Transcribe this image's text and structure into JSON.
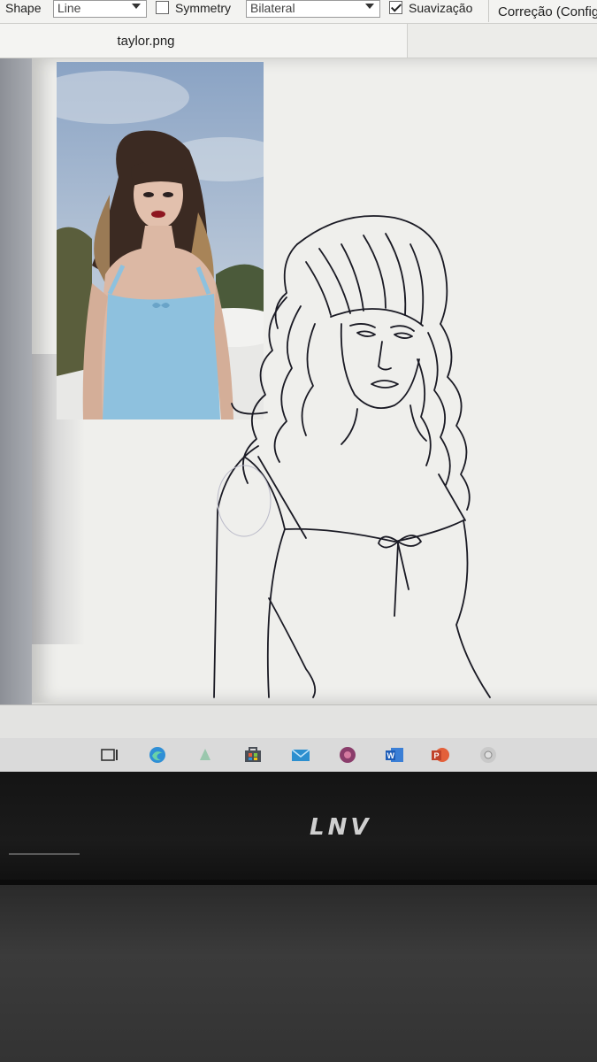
{
  "toolbar": {
    "shape_label": "Shape",
    "shape_value": "Line",
    "symmetry_label": "Symmetry",
    "symmetry_checked": false,
    "symmetry_value": "Bilateral",
    "smoothing_label": "Suavização",
    "smoothing_checked": true,
    "correction_label": "Correção (Config"
  },
  "document": {
    "tab_title": "taylor.png"
  },
  "taskbar": {
    "icons": [
      "task-view-icon",
      "edge-browser-icon",
      "app-icon",
      "store-icon",
      "mail-icon",
      "media-app-icon",
      "word-icon",
      "powerpoint-icon",
      "chrome-icon"
    ]
  },
  "laptop": {
    "logo": "LNV"
  },
  "colors": {
    "toolbar_bg": "#f3f3f1",
    "canvas_bg": "#efefec",
    "bezel": "#161616",
    "dress_blue": "#8ec1de",
    "sky_blue": "#9fb4ce",
    "sketch_ink": "#1a1a24"
  }
}
